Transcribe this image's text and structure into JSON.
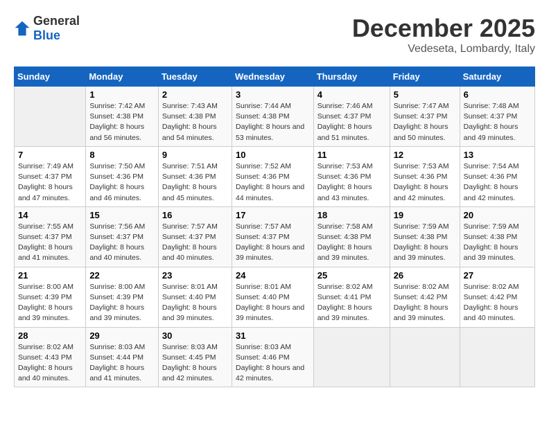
{
  "logo": {
    "general": "General",
    "blue": "Blue"
  },
  "title": "December 2025",
  "subtitle": "Vedeseta, Lombardy, Italy",
  "days_of_week": [
    "Sunday",
    "Monday",
    "Tuesday",
    "Wednesday",
    "Thursday",
    "Friday",
    "Saturday"
  ],
  "weeks": [
    [
      {
        "day": null,
        "info": null
      },
      {
        "day": "1",
        "sunrise": "7:42 AM",
        "sunset": "4:38 PM",
        "daylight": "8 hours and 56 minutes."
      },
      {
        "day": "2",
        "sunrise": "7:43 AM",
        "sunset": "4:38 PM",
        "daylight": "8 hours and 54 minutes."
      },
      {
        "day": "3",
        "sunrise": "7:44 AM",
        "sunset": "4:38 PM",
        "daylight": "8 hours and 53 minutes."
      },
      {
        "day": "4",
        "sunrise": "7:46 AM",
        "sunset": "4:37 PM",
        "daylight": "8 hours and 51 minutes."
      },
      {
        "day": "5",
        "sunrise": "7:47 AM",
        "sunset": "4:37 PM",
        "daylight": "8 hours and 50 minutes."
      },
      {
        "day": "6",
        "sunrise": "7:48 AM",
        "sunset": "4:37 PM",
        "daylight": "8 hours and 49 minutes."
      }
    ],
    [
      {
        "day": "7",
        "sunrise": "7:49 AM",
        "sunset": "4:37 PM",
        "daylight": "8 hours and 47 minutes."
      },
      {
        "day": "8",
        "sunrise": "7:50 AM",
        "sunset": "4:36 PM",
        "daylight": "8 hours and 46 minutes."
      },
      {
        "day": "9",
        "sunrise": "7:51 AM",
        "sunset": "4:36 PM",
        "daylight": "8 hours and 45 minutes."
      },
      {
        "day": "10",
        "sunrise": "7:52 AM",
        "sunset": "4:36 PM",
        "daylight": "8 hours and 44 minutes."
      },
      {
        "day": "11",
        "sunrise": "7:53 AM",
        "sunset": "4:36 PM",
        "daylight": "8 hours and 43 minutes."
      },
      {
        "day": "12",
        "sunrise": "7:53 AM",
        "sunset": "4:36 PM",
        "daylight": "8 hours and 42 minutes."
      },
      {
        "day": "13",
        "sunrise": "7:54 AM",
        "sunset": "4:36 PM",
        "daylight": "8 hours and 42 minutes."
      }
    ],
    [
      {
        "day": "14",
        "sunrise": "7:55 AM",
        "sunset": "4:37 PM",
        "daylight": "8 hours and 41 minutes."
      },
      {
        "day": "15",
        "sunrise": "7:56 AM",
        "sunset": "4:37 PM",
        "daylight": "8 hours and 40 minutes."
      },
      {
        "day": "16",
        "sunrise": "7:57 AM",
        "sunset": "4:37 PM",
        "daylight": "8 hours and 40 minutes."
      },
      {
        "day": "17",
        "sunrise": "7:57 AM",
        "sunset": "4:37 PM",
        "daylight": "8 hours and 39 minutes."
      },
      {
        "day": "18",
        "sunrise": "7:58 AM",
        "sunset": "4:38 PM",
        "daylight": "8 hours and 39 minutes."
      },
      {
        "day": "19",
        "sunrise": "7:59 AM",
        "sunset": "4:38 PM",
        "daylight": "8 hours and 39 minutes."
      },
      {
        "day": "20",
        "sunrise": "7:59 AM",
        "sunset": "4:38 PM",
        "daylight": "8 hours and 39 minutes."
      }
    ],
    [
      {
        "day": "21",
        "sunrise": "8:00 AM",
        "sunset": "4:39 PM",
        "daylight": "8 hours and 39 minutes."
      },
      {
        "day": "22",
        "sunrise": "8:00 AM",
        "sunset": "4:39 PM",
        "daylight": "8 hours and 39 minutes."
      },
      {
        "day": "23",
        "sunrise": "8:01 AM",
        "sunset": "4:40 PM",
        "daylight": "8 hours and 39 minutes."
      },
      {
        "day": "24",
        "sunrise": "8:01 AM",
        "sunset": "4:40 PM",
        "daylight": "8 hours and 39 minutes."
      },
      {
        "day": "25",
        "sunrise": "8:02 AM",
        "sunset": "4:41 PM",
        "daylight": "8 hours and 39 minutes."
      },
      {
        "day": "26",
        "sunrise": "8:02 AM",
        "sunset": "4:42 PM",
        "daylight": "8 hours and 39 minutes."
      },
      {
        "day": "27",
        "sunrise": "8:02 AM",
        "sunset": "4:42 PM",
        "daylight": "8 hours and 40 minutes."
      }
    ],
    [
      {
        "day": "28",
        "sunrise": "8:02 AM",
        "sunset": "4:43 PM",
        "daylight": "8 hours and 40 minutes."
      },
      {
        "day": "29",
        "sunrise": "8:03 AM",
        "sunset": "4:44 PM",
        "daylight": "8 hours and 41 minutes."
      },
      {
        "day": "30",
        "sunrise": "8:03 AM",
        "sunset": "4:45 PM",
        "daylight": "8 hours and 42 minutes."
      },
      {
        "day": "31",
        "sunrise": "8:03 AM",
        "sunset": "4:46 PM",
        "daylight": "8 hours and 42 minutes."
      },
      {
        "day": null,
        "info": null
      },
      {
        "day": null,
        "info": null
      },
      {
        "day": null,
        "info": null
      }
    ]
  ]
}
